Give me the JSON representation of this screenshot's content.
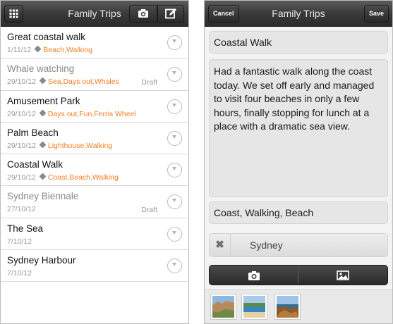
{
  "left": {
    "title": "Family Trips",
    "trips": [
      {
        "title": "Great coastal walk",
        "date": "1/11/12",
        "tags": "Beach,Walking",
        "draft": ""
      },
      {
        "title": "Whale watching",
        "date": "29/10/12",
        "tags": "Sea,Days out,Whales",
        "draft": "Draft"
      },
      {
        "title": "Amusement Park",
        "date": "29/10/12",
        "tags": "Days out,Fun,Ferris Wheel",
        "draft": ""
      },
      {
        "title": "Palm Beach",
        "date": "29/10/12",
        "tags": "Lighthouse,Walking",
        "draft": ""
      },
      {
        "title": "Coastal Walk",
        "date": "29/10/12",
        "tags": "Coast,Beach,Walking",
        "draft": ""
      },
      {
        "title": "Sydney Biennale",
        "date": "27/10/12",
        "tags": "",
        "draft": "Draft"
      },
      {
        "title": "The Sea",
        "date": "7/10/12",
        "tags": "",
        "draft": ""
      },
      {
        "title": "Sydney Harbour",
        "date": "7/10/12",
        "tags": "",
        "draft": ""
      }
    ],
    "icons": [
      "grid-icon",
      "camera-icon",
      "compose-icon",
      "tag-icon",
      "disclosure-icon"
    ]
  },
  "right": {
    "title": "Family Trips",
    "cancel_label": "Cancel",
    "save_label": "Save",
    "trip_title": "Coastal Walk",
    "trip_body": "Had a fantastic walk along the coast today. We set off early and managed to visit four beaches in only a few hours, finally stopping for lunch at a place with a dramatic sea view.",
    "trip_tags": "Coast, Walking, Beach",
    "location": "Sydney",
    "clear_glyph": "✖",
    "icons": [
      "camera-icon",
      "photo-library-icon"
    ],
    "thumbnails": [
      "coastal-cliffs-photo",
      "beach-photo",
      "rock-shore-photo"
    ]
  },
  "colors": {
    "tag_orange": "#f47c20",
    "navbar_dark": "#333333",
    "field_gray": "#e6e6e6"
  }
}
